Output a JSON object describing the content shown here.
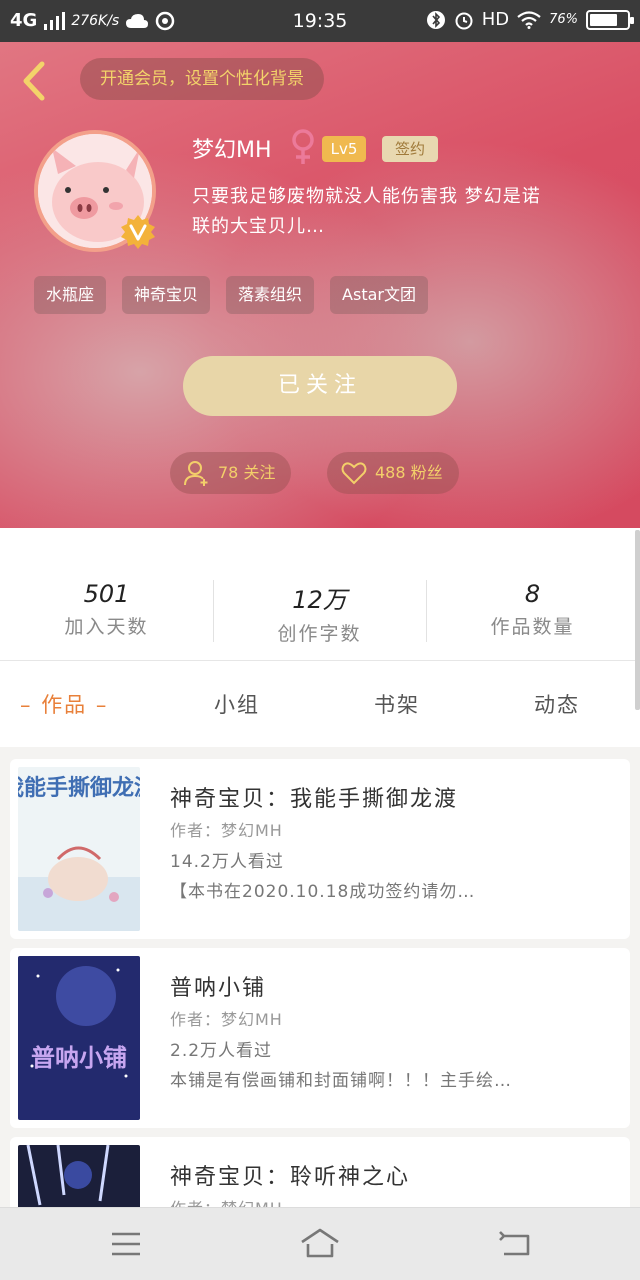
{
  "status_bar": {
    "network": "4G",
    "speed": "276K/s",
    "time": "19:35",
    "hd": "HD",
    "battery_pct": "76%",
    "battery_level": 0.76
  },
  "header": {
    "vip_banner": "开通会员，设置个性化背景",
    "username": "梦幻MH",
    "level": "Lv5",
    "sign_badge": "签约",
    "bio": "只要我足够废物就没人能伤害我 梦幻是诺联的大宝贝儿…",
    "tags": [
      "水瓶座",
      "神奇宝贝",
      "落素组织",
      "Astar文团"
    ],
    "follow_button": "已关注",
    "following": "78 关注",
    "fans": "488 粉丝"
  },
  "stats": [
    {
      "value": "501",
      "label": "加入天数"
    },
    {
      "value": "12万",
      "label": "创作字数"
    },
    {
      "value": "8",
      "label": "作品数量"
    }
  ],
  "tabs": [
    "作品",
    "小组",
    "书架",
    "动态"
  ],
  "works": [
    {
      "title": "神奇宝贝：我能手撕御龙渡",
      "author": "作者：梦幻MH",
      "views": "14.2万人看过",
      "desc": "【本书在2020.10.18成功签约请勿…",
      "cover_text": "我能手撕御龙渡"
    },
    {
      "title": "普呐小铺",
      "author": "作者：梦幻MH",
      "views": "2.2万人看过",
      "desc": "本铺是有偿画铺和封面铺啊！！！主手绘…",
      "cover_text": "普呐小铺"
    },
    {
      "title": "神奇宝贝：聆听神之心",
      "author": "作者：梦幻MH",
      "views": "",
      "desc": "",
      "cover_text": ""
    }
  ],
  "colors": {
    "accent": "#e8803a",
    "header_red": "#d94f64",
    "gold": "#f3cf6a"
  }
}
